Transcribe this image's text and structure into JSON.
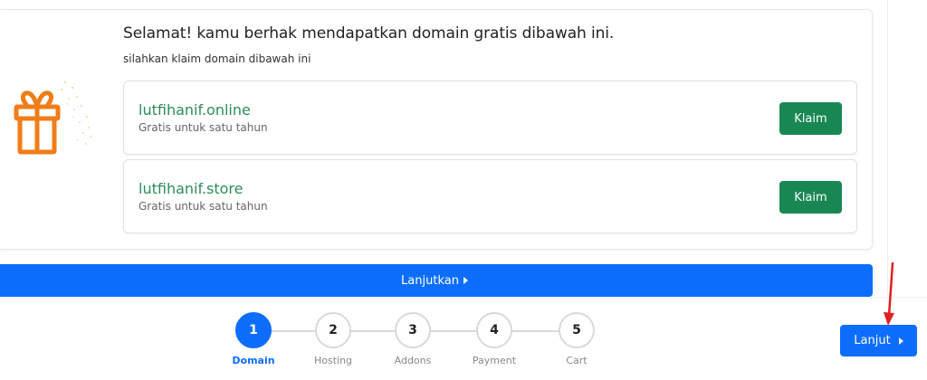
{
  "promo": {
    "headline": "Selamat! kamu berhak mendapatkan domain gratis dibawah ini.",
    "subline": "silahkan klaim domain dibawah ini",
    "gift_icon": "gift-icon"
  },
  "domains": [
    {
      "name": "lutfihanif.online",
      "note": "Gratis untuk satu tahun",
      "claim_label": "Klaim"
    },
    {
      "name": "lutfihanif.store",
      "note": "Gratis untuk satu tahun",
      "claim_label": "Klaim"
    }
  ],
  "continue_bar": {
    "label": "Lanjutkan"
  },
  "steps": [
    {
      "number": "1",
      "label": "Domain",
      "active": true
    },
    {
      "number": "2",
      "label": "Hosting",
      "active": false
    },
    {
      "number": "3",
      "label": "Addons",
      "active": false
    },
    {
      "number": "4",
      "label": "Payment",
      "active": false
    },
    {
      "number": "5",
      "label": "Cart",
      "active": false
    }
  ],
  "next_button": {
    "label": "Lanjut"
  },
  "colors": {
    "primary": "#0d6efd",
    "success": "#198754",
    "domain_text": "#2e8b57",
    "gift": "#f07d17",
    "annotation_arrow": "#e02020"
  }
}
